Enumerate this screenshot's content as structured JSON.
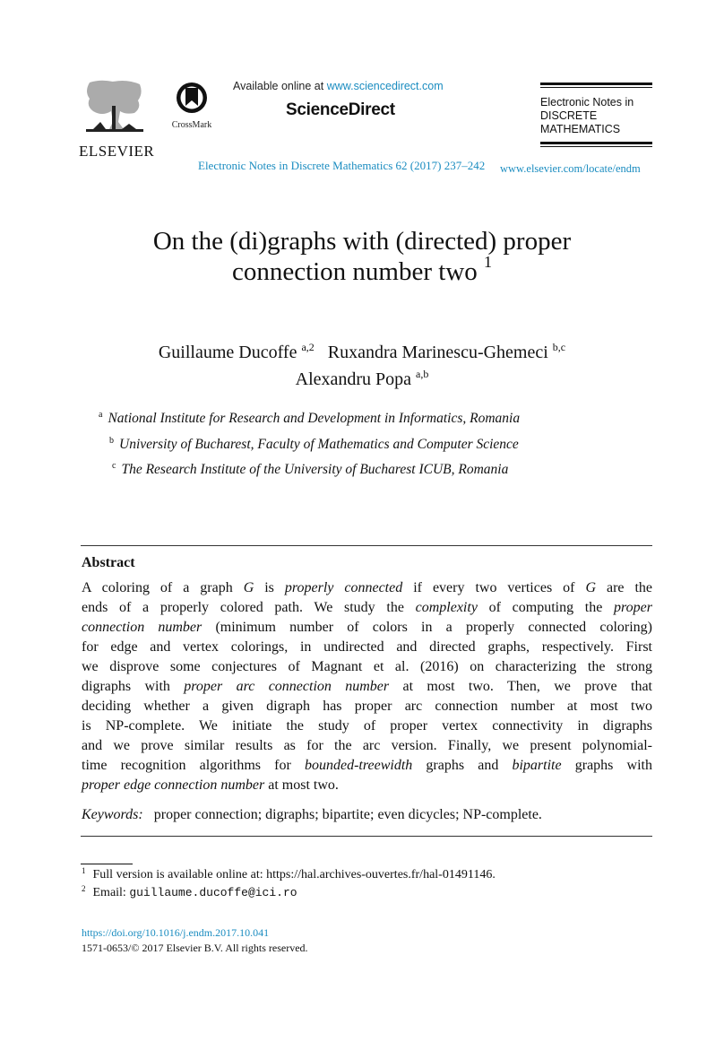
{
  "header": {
    "publisher_logo_text": "ELSEVIER",
    "crossmark_label": "CrossMark",
    "available_prefix": "Available online at ",
    "available_link": "www.sciencedirect.com",
    "platform_name": "ScienceDirect",
    "journal_citation": "Electronic Notes in Discrete Mathematics 62 (2017) 237–242",
    "journal_brand_lines": [
      "Electronic Notes in",
      "DISCRETE",
      "MATHEMATICS"
    ],
    "journal_url": "www.elsevier.com/locate/endm",
    "link_color": "#1a8cc0"
  },
  "paper": {
    "title_line1": "On the (di)graphs with (directed) proper",
    "title_line2": "connection number two",
    "title_footnote_mark": "1",
    "authors": [
      {
        "name": "Guillaume Ducoffe",
        "marks": "a,2"
      },
      {
        "name": "Ruxandra Marinescu-Ghemeci",
        "marks": "b,c"
      },
      {
        "name": "Alexandru Popa",
        "marks": "a,b"
      }
    ],
    "affiliations": [
      {
        "mark": "a",
        "text": "National Institute for Research and Development in Informatics, Romania"
      },
      {
        "mark": "b",
        "text": "University of Bucharest, Faculty of Mathematics and Computer Science"
      },
      {
        "mark": "c",
        "text": "The Research Institute of the University of Bucharest ICUB, Romania"
      }
    ]
  },
  "abstract": {
    "heading": "Abstract",
    "lines": [
      [
        {
          "t": "A coloring of a graph "
        },
        {
          "t": "G",
          "i": true
        },
        {
          "t": " is "
        },
        {
          "t": "properly connected",
          "i": true
        },
        {
          "t": " if every two vertices of "
        },
        {
          "t": "G",
          "i": true
        },
        {
          "t": " are the"
        }
      ],
      [
        {
          "t": "ends of a properly colored path. We study the "
        },
        {
          "t": "complexity",
          "i": true
        },
        {
          "t": " of computing the "
        },
        {
          "t": "proper",
          "i": true
        }
      ],
      [
        {
          "t": "connection number",
          "i": true
        },
        {
          "t": " (minimum number of colors in a properly connected coloring)"
        }
      ],
      [
        {
          "t": "for edge and vertex colorings, in undirected and directed graphs, respectively. First"
        }
      ],
      [
        {
          "t": "we disprove some conjectures of Magnant et al. (2016) on characterizing the strong"
        }
      ],
      [
        {
          "t": "digraphs with "
        },
        {
          "t": "proper arc connection number",
          "i": true
        },
        {
          "t": " at most two. Then, we prove that"
        }
      ],
      [
        {
          "t": "deciding whether a given digraph has proper arc connection number at most two"
        }
      ],
      [
        {
          "t": "is NP-complete. We initiate the study of proper vertex connectivity in digraphs"
        }
      ],
      [
        {
          "t": "and we prove similar results as for the arc version. Finally, we present polynomial-"
        }
      ],
      [
        {
          "t": "time recognition algorithms for "
        },
        {
          "t": "bounded-treewidth",
          "i": true
        },
        {
          "t": " graphs and "
        },
        {
          "t": "bipartite",
          "i": true
        },
        {
          "t": " graphs with"
        }
      ],
      [
        {
          "t": "proper edge connection number",
          "i": true
        },
        {
          "t": " at most two."
        }
      ]
    ],
    "keywords_label": "Keywords:",
    "keywords": "proper connection; digraphs; bipartite; even dicycles; NP-complete."
  },
  "footnotes": [
    {
      "mark": "1",
      "text": "Full version is available online at: https://hal.archives-ouvertes.fr/hal-01491146."
    },
    {
      "mark": "2",
      "label": "Email: ",
      "email": "guillaume.ducoffe@ici.ro"
    }
  ],
  "footer": {
    "doi": "https://doi.org/10.1016/j.endm.2017.10.041",
    "copyright": "1571-0653/© 2017 Elsevier B.V. All rights reserved."
  }
}
